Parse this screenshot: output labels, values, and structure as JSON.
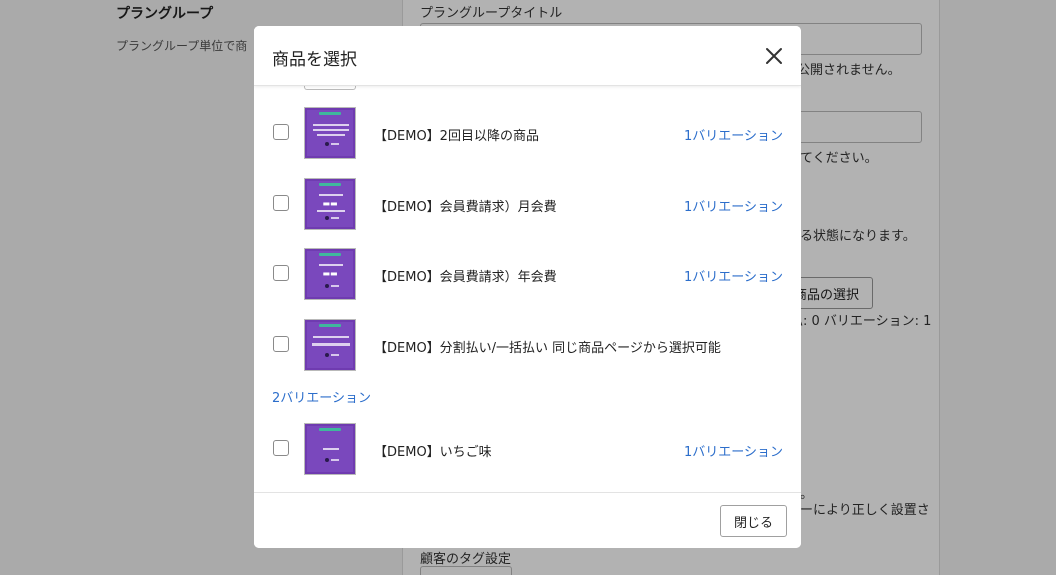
{
  "background": {
    "left_title": "プラングループ",
    "left_desc": "プラングループ単位で商",
    "field_label_title": "プラングループタイトル",
    "note_1": "公開されません。",
    "note_2": "てください。",
    "note_3": "る状態になります。",
    "select_button": "商品の選択",
    "summary": "払: 0 バリエーション: 1",
    "note_4": "。",
    "note_5": "ーにより正しく設置さ",
    "tag_label": "顧客のタグ設定"
  },
  "modal": {
    "title": "商品を選択",
    "close_label": "閉じる",
    "products": [
      {
        "name": "【DEMO】2回目以降の商品",
        "variation": "1バリエーション",
        "thumb": "text-lines"
      },
      {
        "name": "【DEMO】会員費請求）月会費",
        "variation": "1バリエーション",
        "thumb": "monthly"
      },
      {
        "name": "【DEMO】会員費請求）年会費",
        "variation": "1バリエーション",
        "thumb": "yearly"
      },
      {
        "name": "【DEMO】分割払い/一括払い 同じ商品ページから選択可能",
        "variation": "",
        "thumb": "installment"
      },
      {
        "name": "【DEMO】いちご味",
        "variation": "1バリエーション",
        "thumb": "strawberry"
      }
    ]
  },
  "callout": {
    "text": "2バリエーション"
  },
  "icons": {
    "close": "close-icon",
    "arrow": "arrow-down-left-icon"
  },
  "colors": {
    "link": "#2c6ecb",
    "thumb_purple": "#7a48bd",
    "thumb_tag": "#3fb89c"
  }
}
